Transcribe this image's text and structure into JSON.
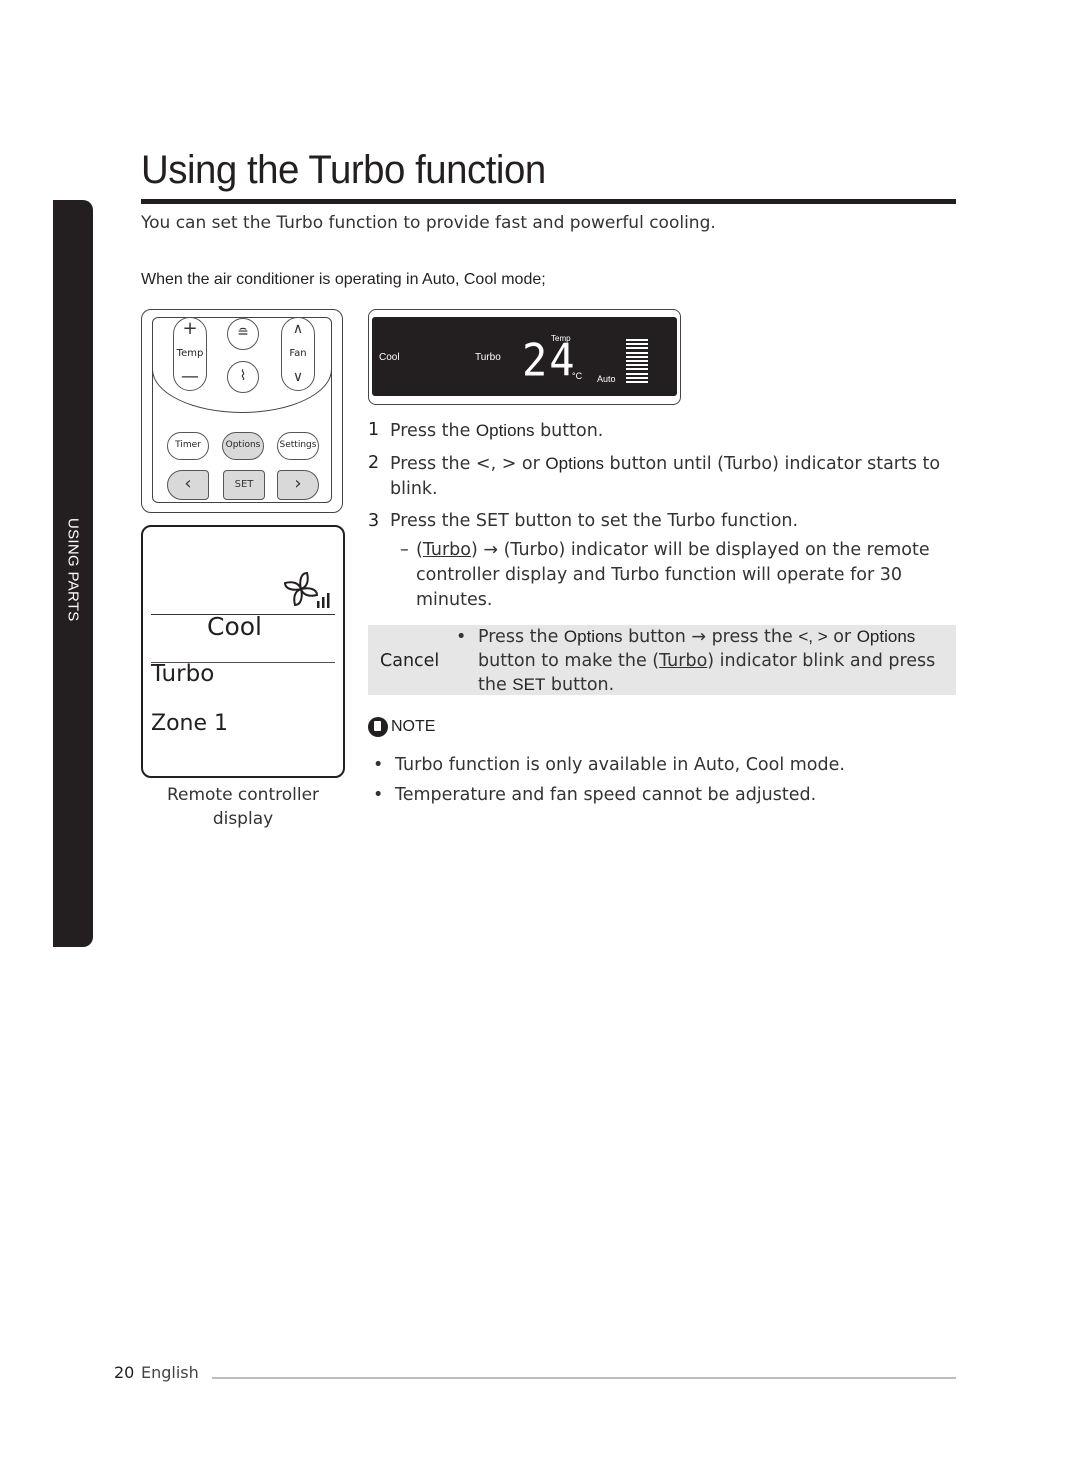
{
  "side_tab": {
    "label": "USING PARTS"
  },
  "page": {
    "title": "Using the Turbo function",
    "intro": "You can set the Turbo function to provide fast and powerful cooling.",
    "condition": "When the air conditioner is operating in Auto, Cool mode;"
  },
  "remote": {
    "temp_plus": "+",
    "temp_label": "Temp",
    "temp_minus": "—",
    "fan_up": "∧",
    "fan_label": "Fan",
    "fan_down": "∨",
    "swing_icon": "≘",
    "windfree_icon": "⌇",
    "timer": "Timer",
    "options": "Options",
    "settings": "Settings",
    "left": "‹",
    "set": "SET",
    "right": "›"
  },
  "lcd": {
    "mode": "Cool",
    "function": "Turbo",
    "temp_label": "Temp",
    "temperature": "24",
    "unit": "°C",
    "fan": "Auto"
  },
  "remote_display": {
    "mode": "Cool",
    "function": "Turbo",
    "zone": "Zone  1",
    "caption_line1": "Remote controller",
    "caption_line2": "display"
  },
  "steps": [
    {
      "num": "1",
      "pre": "Press the ",
      "em": "Options",
      "post": " button."
    },
    {
      "num": "2",
      "pre": "Press the <, > or ",
      "em": "Options",
      "post": " button until (Turbo) indicator starts to blink."
    },
    {
      "num": "3",
      "pre": "Press the SET button to set the Turbo function.",
      "em": "",
      "post": ""
    }
  ],
  "step3_sub": {
    "dash": "–",
    "open": "(",
    "turbo": "Turbo",
    "rest": ") → (Turbo) indicator will be displayed on the remote controller display and Turbo function will operate for 30 minutes."
  },
  "cancel": {
    "label": "Cancel",
    "bullet": "•",
    "t1": "Press the ",
    "em1": "Options",
    "t2": " button →  press the ",
    "em2": "<, >",
    "t3": " or ",
    "em3": "Options",
    "t4": " button to make the (",
    "turbo": "Turbo",
    "t5": ") indicator blink and press the ",
    "em4": "SET",
    "t6": " button."
  },
  "note": {
    "heading": "NOTE",
    "items": [
      "Turbo function is only available in Auto, Cool mode.",
      "Temperature and fan speed cannot be adjusted."
    ]
  },
  "footer": {
    "page_number": "20",
    "language": "English"
  }
}
